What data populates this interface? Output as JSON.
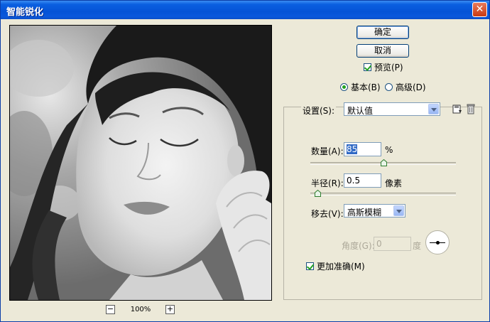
{
  "window": {
    "title": "智能锐化",
    "close_glyph": "✕"
  },
  "preview": {
    "zoom_out_glyph": "−",
    "zoom_in_glyph": "+",
    "zoom_level": "100%"
  },
  "buttons": {
    "ok": "确定",
    "cancel": "取消"
  },
  "preview_checkbox": {
    "label": "预览(P)",
    "checked": true
  },
  "mode": {
    "basic": "基本(B)",
    "advanced": "高级(D)",
    "selected": "basic"
  },
  "settings": {
    "label": "设置(S):",
    "value": "默认值"
  },
  "amount": {
    "label": "数量(A):",
    "value": "85",
    "unit": "%",
    "slider_fraction": 0.5
  },
  "radius": {
    "label": "半径(R):",
    "value": "0.5",
    "unit": "像素",
    "slider_fraction": 0.05
  },
  "remove": {
    "label": "移去(V):",
    "value": "高斯模糊"
  },
  "angle": {
    "label": "角度(G):",
    "value": "0",
    "unit": "度"
  },
  "more_accurate": {
    "label": "更加准确(M)",
    "checked": true
  },
  "icons": {
    "save": "save-settings-icon",
    "delete": "trash-icon"
  }
}
